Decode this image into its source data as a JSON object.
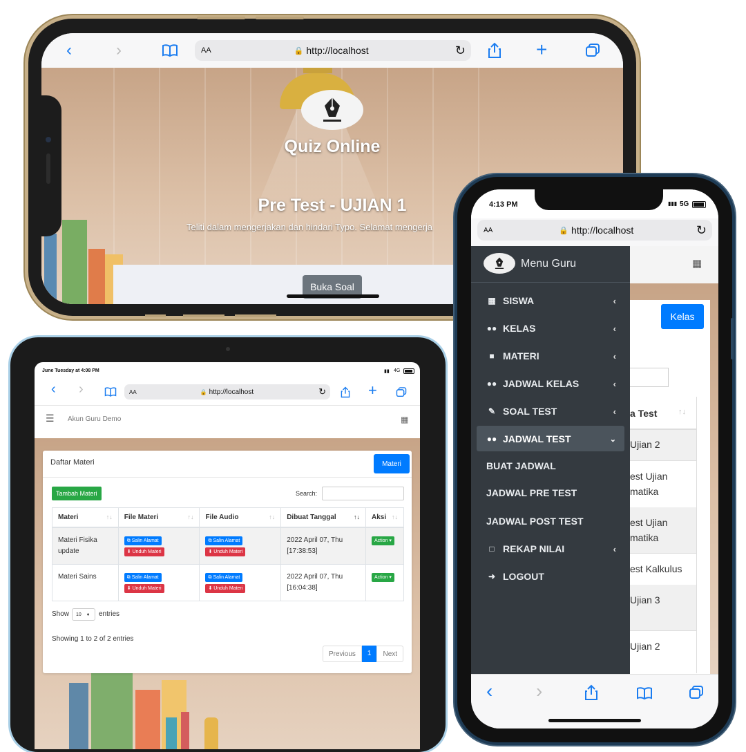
{
  "safari": {
    "url": "http://localhost",
    "text_size": "AA",
    "lock_icon": "lock-icon"
  },
  "landscape_phone": {
    "app_title": "Quiz Online",
    "test_title": "Pre Test - UJIAN 1",
    "instruction": "Teliti dalam mengerjakan dan hindari Typo. Selamat mengerja",
    "open_button": "Buka Soal"
  },
  "tablet": {
    "status_time": "June Tuesday at 4:08 PM",
    "status_net": "4G",
    "header_user": "Akun Guru Demo",
    "card_title": "Daftar Materi",
    "materi_button": "Materi",
    "add_button": "Tambah Materi",
    "search_label": "Search:",
    "columns": [
      "Materi",
      "File Materi",
      "File Audio",
      "Dibuat Tanggal",
      "Aksi"
    ],
    "copy_label": "Salin Alamat",
    "download_label": "Unduh Materi",
    "action_label": "Action",
    "rows": [
      {
        "materi": "Materi Fisika update",
        "date": "2022 April 07, Thu",
        "time": "[17:38:53]"
      },
      {
        "materi": "Materi Sains",
        "date": "2022 April 07, Thu",
        "time": "[16:04:38]"
      }
    ],
    "show_label": "Show",
    "entries_value": "10",
    "entries_label": "entries",
    "info": "Showing 1 to 2 of 2 entries",
    "prev": "Previous",
    "page": "1",
    "next": "Next"
  },
  "portrait_phone": {
    "status_time": "4:13 PM",
    "status_net": "5G",
    "menu_title": "Menu Guru",
    "kelas_button": "Kelas",
    "menu": [
      {
        "label": "SISWA",
        "icon": "building-icon"
      },
      {
        "label": "KELAS",
        "icon": "users-icon"
      },
      {
        "label": "MATERI",
        "icon": "book-icon"
      },
      {
        "label": "JADWAL KELAS",
        "icon": "users-icon"
      },
      {
        "label": "SOAL TEST",
        "icon": "edit-icon"
      },
      {
        "label": "JADWAL TEST",
        "icon": "users-icon"
      }
    ],
    "submenu": [
      "BUAT JADWAL",
      "JADWAL PRE TEST",
      "JADWAL POST TEST"
    ],
    "rekap": "REKAP NILAI",
    "logout": "LOGOUT",
    "bg_header": "a Test",
    "bg_rows": [
      "Ujian 2",
      "est Ujian",
      "matika",
      "est Ujian",
      "matika",
      "est Kalkulus",
      "Ujian 3",
      "Ujian 2"
    ]
  },
  "colors": {
    "primary": "#007bff",
    "success": "#28a745",
    "danger": "#dc3545",
    "sidebar": "#343a40",
    "safari_blue": "#1a7cf0"
  }
}
